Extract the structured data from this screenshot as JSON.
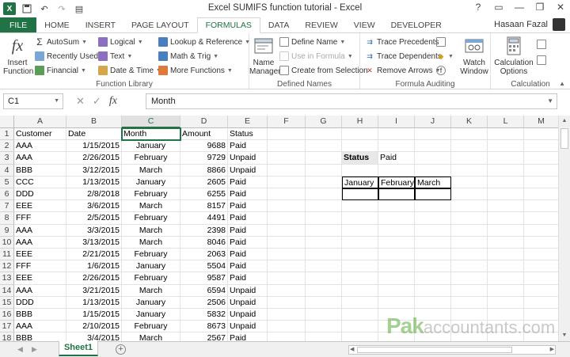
{
  "window": {
    "title": "Excel SUMIFS function tutorial - Excel",
    "user": "Hasaan Fazal",
    "controls": [
      "?",
      "▭",
      "—",
      "❐",
      "✕"
    ]
  },
  "tabs": [
    "FILE",
    "HOME",
    "INSERT",
    "PAGE LAYOUT",
    "FORMULAS",
    "DATA",
    "REVIEW",
    "VIEW",
    "DEVELOPER"
  ],
  "active_tab": "FORMULAS",
  "ribbon": {
    "function_library": {
      "label": "Function Library",
      "insert_function": "Insert Function",
      "autosum": "AutoSum",
      "recently_used": "Recently Used",
      "financial": "Financial",
      "logical": "Logical",
      "text": "Text",
      "date_time": "Date & Time",
      "lookup_reference": "Lookup & Reference",
      "math_trig": "Math & Trig",
      "more_functions": "More Functions"
    },
    "defined_names": {
      "label": "Defined Names",
      "name_manager": "Name Manager",
      "define_name": "Define Name",
      "use_in_formula": "Use in Formula",
      "create_from_selection": "Create from Selection"
    },
    "formula_auditing": {
      "label": "Formula Auditing",
      "trace_precedents": "Trace Precedents",
      "trace_dependents": "Trace Dependents",
      "remove_arrows": "Remove Arrows",
      "watch_window": "Watch Window"
    },
    "calculation": {
      "label": "Calculation",
      "calculation_options": "Calculation Options"
    }
  },
  "formula_bar": {
    "name_box": "C1",
    "content": "Month"
  },
  "columns": [
    "A",
    "B",
    "C",
    "D",
    "E",
    "F",
    "G",
    "H",
    "I",
    "J",
    "K",
    "L",
    "M"
  ],
  "rows": [
    "1",
    "2",
    "3",
    "4",
    "5",
    "6",
    "7",
    "8",
    "9",
    "10",
    "11",
    "12",
    "13",
    "14",
    "15",
    "16",
    "17",
    "18"
  ],
  "table": {
    "headers": [
      "Customer",
      "Date",
      "Month",
      "Amount",
      "Status"
    ],
    "data": [
      [
        "AAA",
        "1/15/2015",
        "January",
        "9688",
        "Paid"
      ],
      [
        "AAA",
        "2/26/2015",
        "February",
        "9729",
        "Unpaid"
      ],
      [
        "BBB",
        "3/12/2015",
        "March",
        "8866",
        "Unpaid"
      ],
      [
        "CCC",
        "1/13/2015",
        "January",
        "2605",
        "Paid"
      ],
      [
        "DDD",
        "2/8/2018",
        "February",
        "6255",
        "Paid"
      ],
      [
        "EEE",
        "3/6/2015",
        "March",
        "8157",
        "Paid"
      ],
      [
        "FFF",
        "2/5/2015",
        "February",
        "4491",
        "Paid"
      ],
      [
        "AAA",
        "3/3/2015",
        "March",
        "2398",
        "Paid"
      ],
      [
        "AAA",
        "3/13/2015",
        "March",
        "8046",
        "Paid"
      ],
      [
        "EEE",
        "2/21/2015",
        "February",
        "2063",
        "Paid"
      ],
      [
        "FFF",
        "1/6/2015",
        "January",
        "5504",
        "Paid"
      ],
      [
        "EEE",
        "2/26/2015",
        "February",
        "9587",
        "Paid"
      ],
      [
        "AAA",
        "3/21/2015",
        "March",
        "6594",
        "Unpaid"
      ],
      [
        "DDD",
        "1/13/2015",
        "January",
        "2506",
        "Unpaid"
      ],
      [
        "BBB",
        "1/15/2015",
        "January",
        "5832",
        "Unpaid"
      ],
      [
        "AAA",
        "2/10/2015",
        "February",
        "8673",
        "Unpaid"
      ],
      [
        "BBB",
        "3/4/2015",
        "March",
        "2567",
        "Paid"
      ]
    ]
  },
  "criteria": {
    "status_label": "Status",
    "status_value": "Paid",
    "months": [
      "January",
      "February",
      "March"
    ]
  },
  "sheet_tab": "Sheet1",
  "watermark": {
    "brand": "Pak",
    "rest": "accountants.com"
  },
  "colors": {
    "excel_green": "#217346"
  }
}
